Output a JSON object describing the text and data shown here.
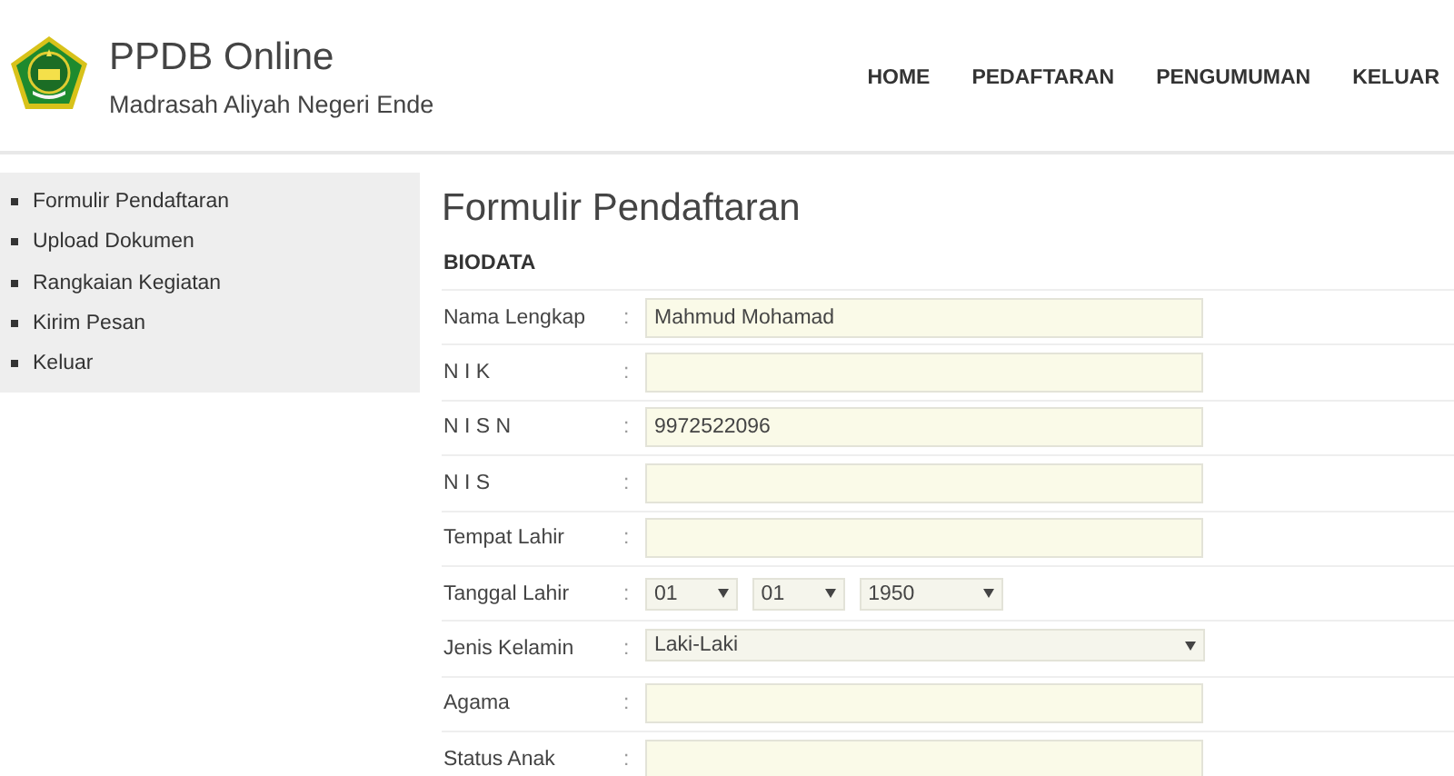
{
  "header": {
    "title": "PPDB Online",
    "subtitle": "Madrasah Aliyah Negeri Ende"
  },
  "nav": [
    {
      "label": "HOME"
    },
    {
      "label": "PEDAFTARAN"
    },
    {
      "label": "PENGUMUMAN"
    },
    {
      "label": "KELUAR"
    }
  ],
  "sidebar": {
    "items": [
      {
        "label": "Formulir Pendaftaran"
      },
      {
        "label": "Upload Dokumen"
      },
      {
        "label": "Rangkaian Kegiatan"
      },
      {
        "label": "Kirim Pesan"
      },
      {
        "label": "Keluar"
      }
    ]
  },
  "form": {
    "title": "Formulir Pendaftaran",
    "section": "BIODATA",
    "rows": [
      {
        "label": "Nama Lengkap",
        "colon": ":",
        "kind": "text",
        "value": "Mahmud Mohamad"
      },
      {
        "label": "N I K",
        "colon": ":",
        "kind": "text"
      },
      {
        "label": "N I S N",
        "colon": ":",
        "kind": "text",
        "value": "9972522096"
      },
      {
        "label": "N I S",
        "colon": ":",
        "kind": "text"
      },
      {
        "label": "Tempat Lahir",
        "colon": ":",
        "kind": "text"
      },
      {
        "label": "Tanggal Lahir",
        "colon": ":",
        "kind": "date",
        "parts": [
          {
            "value": "01"
          },
          {
            "value": "01"
          },
          {
            "value": "1950"
          }
        ]
      },
      {
        "label": "Jenis Kelamin",
        "colon": ":",
        "kind": "select",
        "value": "Laki-Laki"
      },
      {
        "label": "Agama",
        "colon": ":",
        "kind": "text"
      },
      {
        "label": "Status Anak",
        "colon": ":",
        "kind": "text"
      }
    ]
  }
}
